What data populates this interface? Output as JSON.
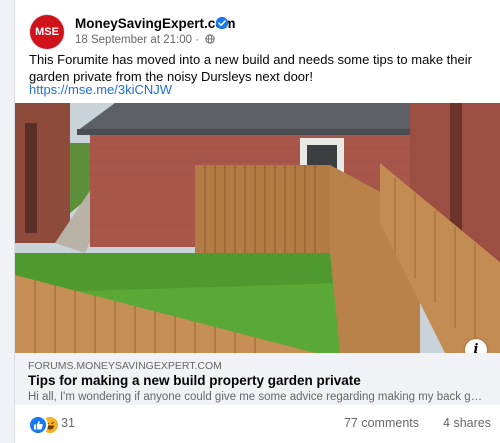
{
  "post": {
    "page_name": "MoneySavingExpert.com",
    "avatar_text": "MSE",
    "timestamp": "18 September at 21:00",
    "dot": "·",
    "text": "This Forumite has moved into a new build and needs some tips to make their garden private from the noisy Dursleys next door!",
    "link": "https://mse.me/3kiCNJW"
  },
  "link_preview": {
    "domain": "FORUMS.MONEYSAVINGEXPERT.COM",
    "title": "Tips for making a new build property garden private",
    "description": "Hi all, I'm wondering if anyone could give me some advice regarding making my back garden more private."
  },
  "engagement": {
    "reaction_count": "31",
    "comments": "77 comments",
    "shares": "4 shares"
  },
  "colors": {
    "brand": "#d0121b",
    "link": "#216fdb",
    "verified": "#1877f2"
  },
  "icons": [
    "verified-icon",
    "globe-icon",
    "info-icon",
    "like-reaction-icon",
    "haha-reaction-icon"
  ]
}
